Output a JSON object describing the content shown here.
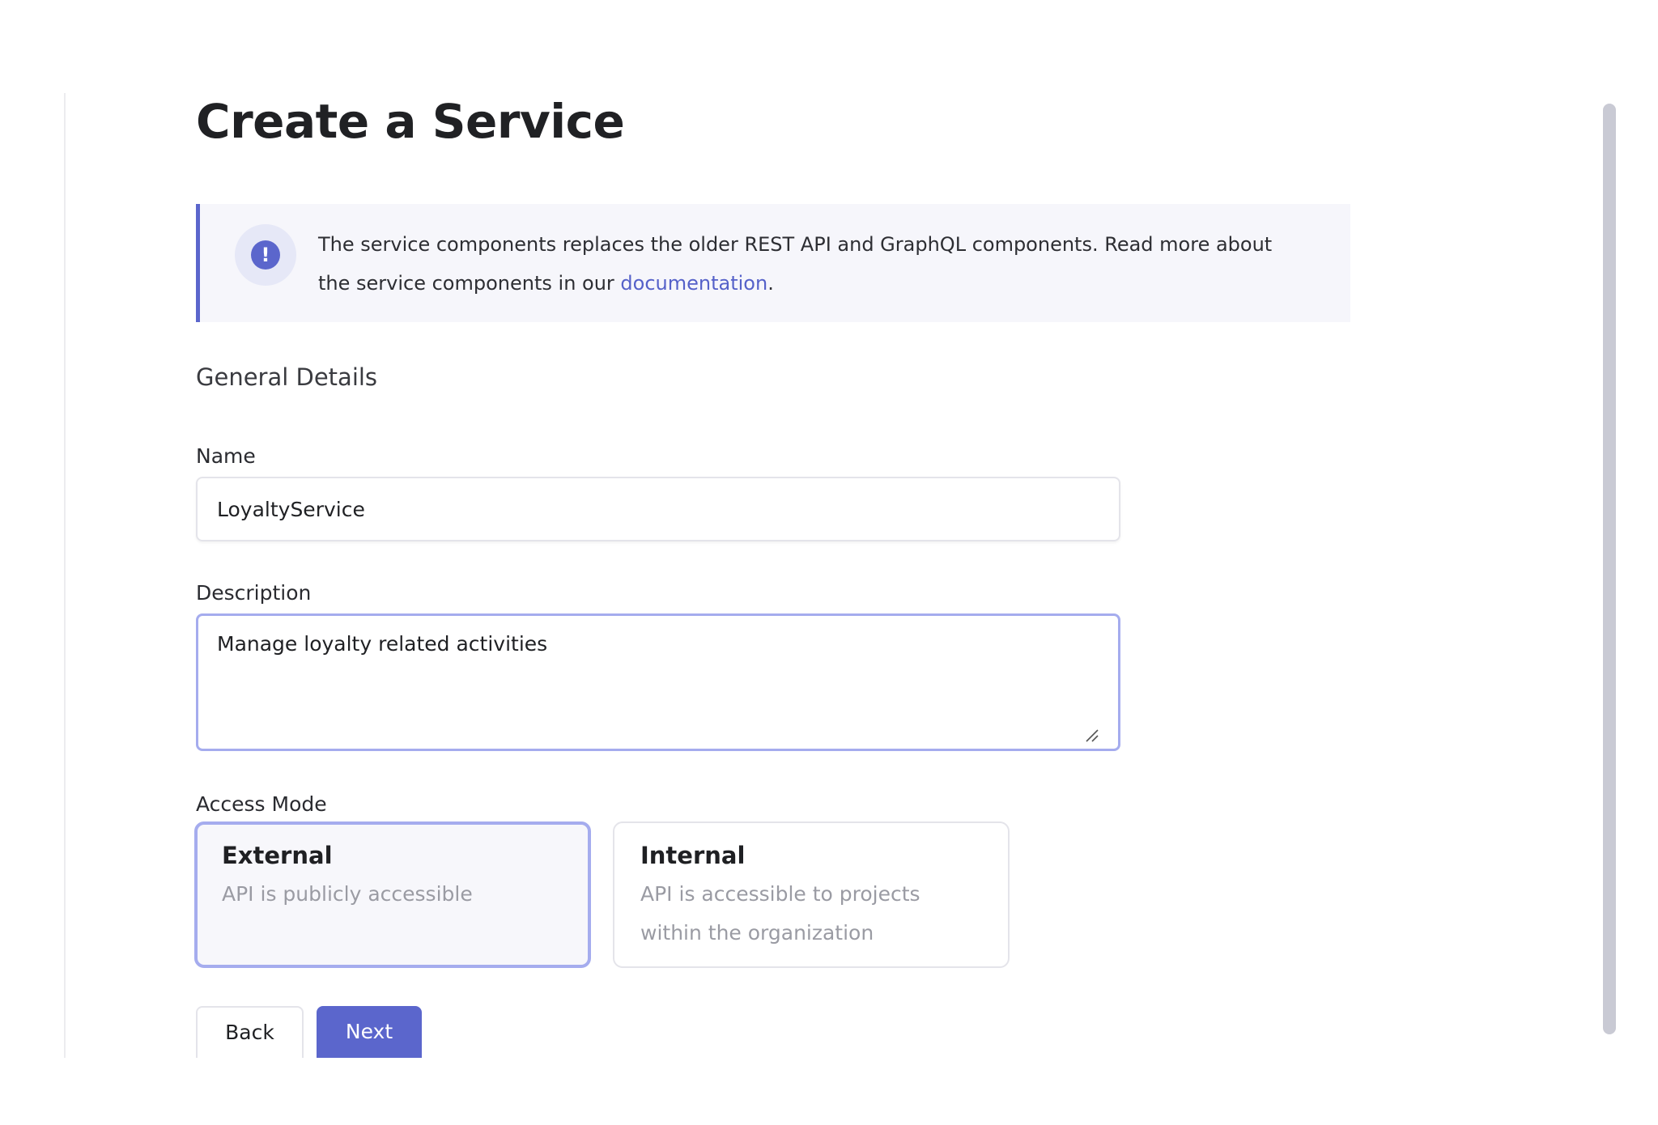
{
  "page": {
    "title": "Create a Service"
  },
  "info_banner": {
    "text_before_link": "The service components replaces the older REST API and GraphQL components. Read more about the service components in our ",
    "link_text": "documentation",
    "text_after_link": ".",
    "icon": "exclamation-icon"
  },
  "general_details": {
    "heading": "General Details",
    "name": {
      "label": "Name",
      "value": "LoyaltyService"
    },
    "description": {
      "label": "Description",
      "value": "Manage loyalty related activities"
    }
  },
  "access_mode": {
    "label": "Access Mode",
    "selected": "External",
    "options": [
      {
        "title": "External",
        "description": "API is publicly accessible"
      },
      {
        "title": "Internal",
        "description": "API is accessible to projects within the organization"
      }
    ]
  },
  "actions": {
    "back_label": "Back",
    "next_label": "Next"
  },
  "colors": {
    "accent": "#5b66cc",
    "focus_border": "#a5acee",
    "banner_background": "#f6f6fb",
    "link": "#5561c9",
    "muted_text": "#9a9ba3"
  }
}
